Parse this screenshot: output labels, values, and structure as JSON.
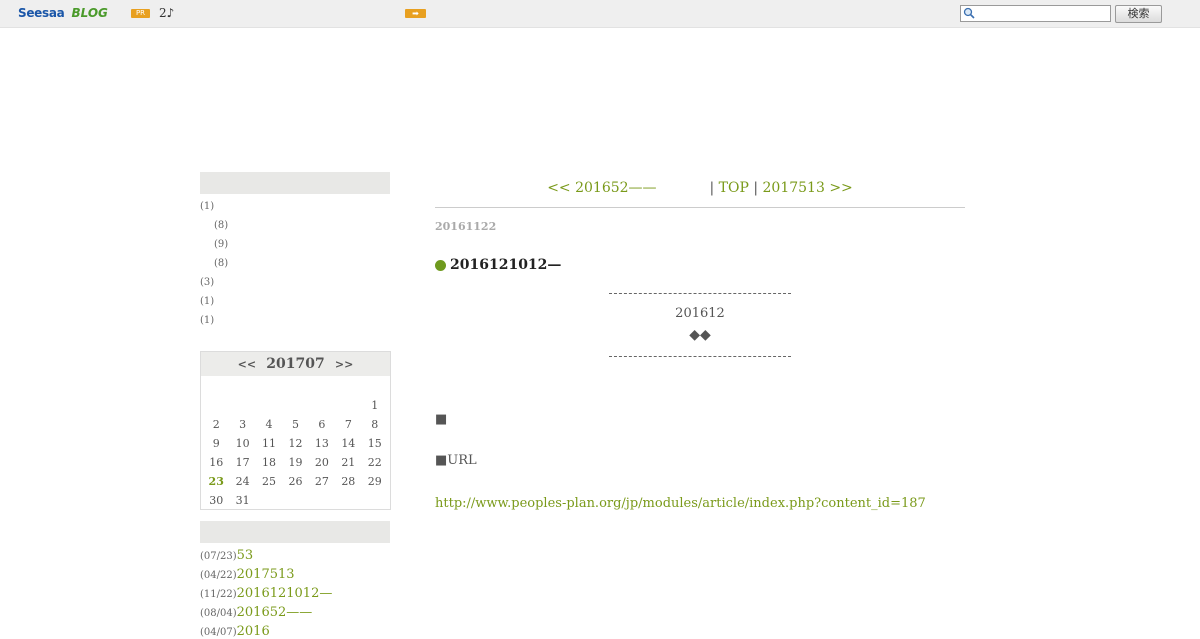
{
  "topbar": {
    "logo_text": "Seesaa",
    "logo_blog": "BLOG",
    "pr_badge": "PR",
    "pr_text": "2♪",
    "arrow_icon": "right-arrow-icon",
    "search_placeholder": "",
    "search_button": "検索"
  },
  "sidebar": {
    "categories": [
      {
        "label": "(1)"
      },
      {
        "label": "(8)"
      },
      {
        "label": "(9)"
      },
      {
        "label": "(8)"
      },
      {
        "label": "(3)"
      },
      {
        "label": "(1)"
      },
      {
        "label": "(1)"
      }
    ],
    "calendar": {
      "prev": "<<",
      "month": "201707",
      "next": ">>",
      "rows": [
        [
          "",
          "",
          "",
          "",
          "",
          "",
          "1"
        ],
        [
          "2",
          "3",
          "4",
          "5",
          "6",
          "7",
          "8"
        ],
        [
          "9",
          "10",
          "11",
          "12",
          "13",
          "14",
          "15"
        ],
        [
          "16",
          "17",
          "18",
          "19",
          "20",
          "21",
          "22"
        ],
        [
          "23",
          "24",
          "25",
          "26",
          "27",
          "28",
          "29"
        ],
        [
          "30",
          "31",
          "",
          "",
          "",
          "",
          ""
        ]
      ],
      "today": "23"
    },
    "recent": [
      {
        "date": "(07/23)",
        "title": "53"
      },
      {
        "date": "(04/22)",
        "title": "2017513"
      },
      {
        "date": "(11/22)",
        "title": "2016121012—"
      },
      {
        "date": "(08/04)",
        "title": "201652——"
      },
      {
        "date": "(04/07)",
        "title": "2016"
      }
    ]
  },
  "main": {
    "nav_prev": "<< 201652——",
    "nav_sep1": "| ",
    "nav_top": "TOP",
    "nav_sep2": " | ",
    "nav_next": "2017513 >>",
    "date": "20161122",
    "title": "2016121012—",
    "center_line1": "201612",
    "center_line2": "◆◆",
    "square_line": "■",
    "url_label": "■URL",
    "url": "http://www.peoples-plan.org/jp/modules/article/index.php?content_id=187"
  },
  "colors": {
    "accent": "#7a9a1a",
    "badge": "#e8a020"
  }
}
